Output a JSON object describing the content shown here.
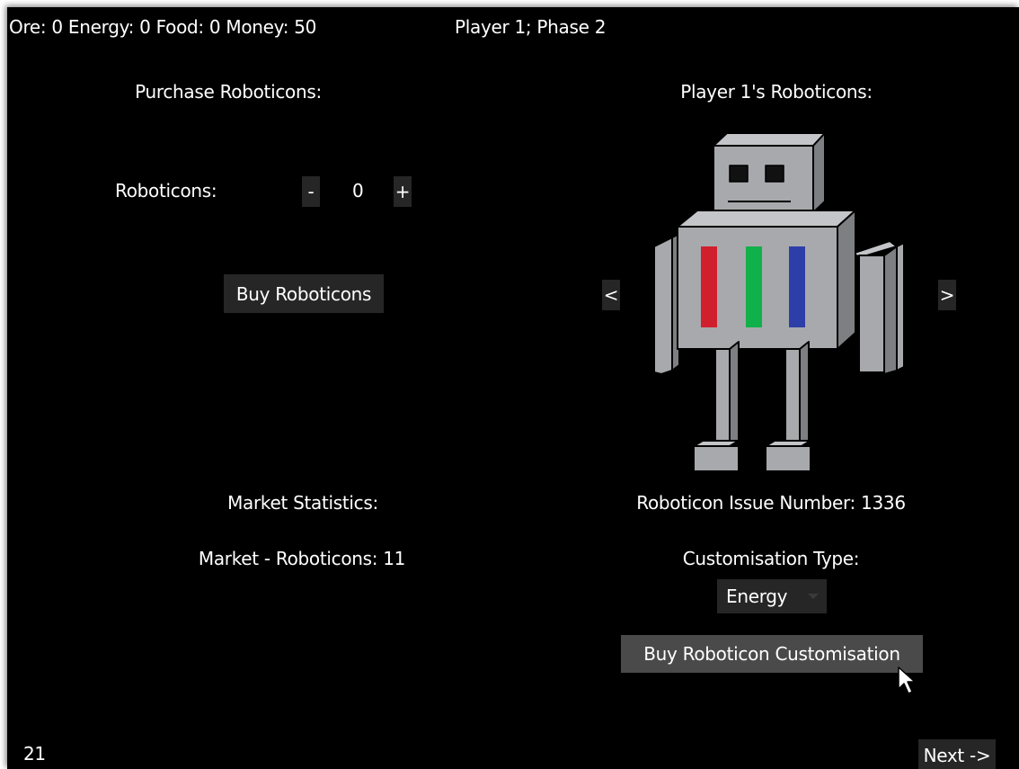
{
  "status_bar": {
    "resources": "Ore: 0 Energy: 0 Food: 0 Money: 50",
    "player_phase": "Player 1; Phase 2"
  },
  "purchase": {
    "heading": "Purchase Roboticons:",
    "quantity_label": "Roboticons:",
    "minus_label": "-",
    "quantity": "0",
    "plus_label": "+",
    "buy_label": "Buy Roboticons"
  },
  "player_roboticons": {
    "heading": "Player 1's Roboticons:",
    "prev_label": "<",
    "next_label": ">",
    "issue_number": "Roboticon Issue Number: 1336",
    "customisation_heading": "Customisation Type:",
    "customisation_selected": "Energy",
    "buy_customisation_label": "Buy Roboticon Customisation",
    "robot_icon": "roboticon-robot",
    "stripe_colors": [
      "#d0202e",
      "#10b04a",
      "#2e3ea8"
    ]
  },
  "market": {
    "heading": "Market Statistics:",
    "roboticons": "Market - Roboticons: 11"
  },
  "footer": {
    "timer": "21",
    "next_label": "Next ->"
  },
  "colors": {
    "background": "#000000",
    "text": "#ffffff",
    "button": "#262626",
    "button_hover": "#4a4a4a",
    "robot_body": "#a8a9ac"
  }
}
